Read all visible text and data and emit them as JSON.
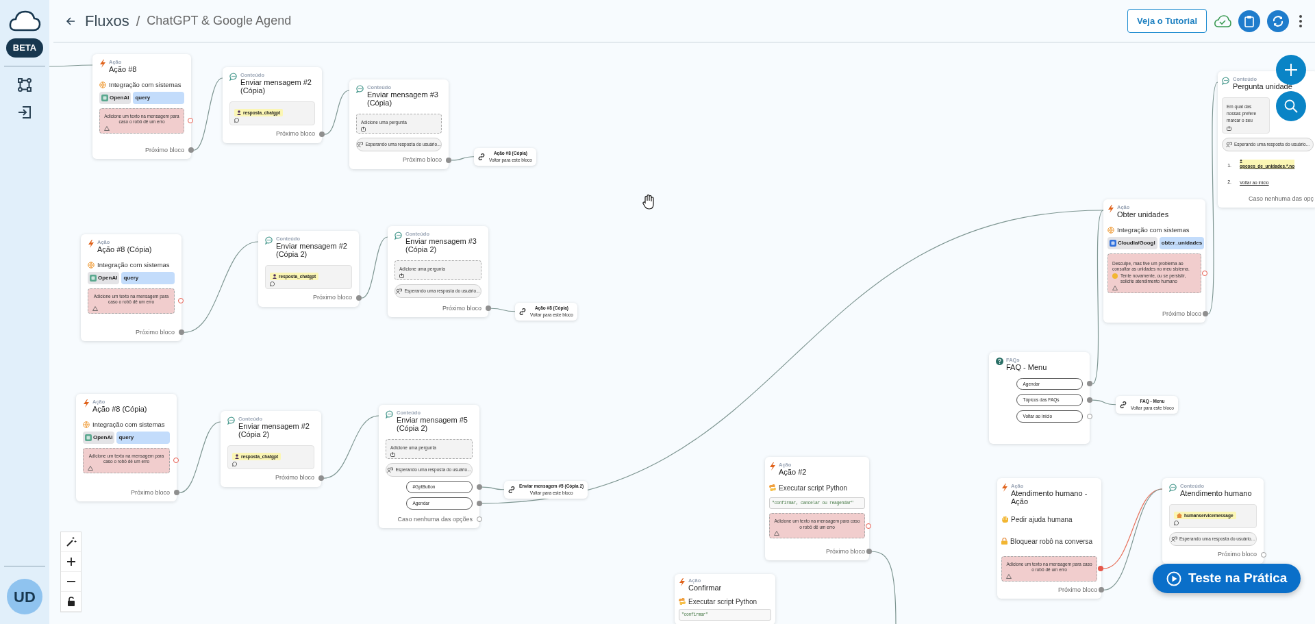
{
  "sidebar": {
    "badge": "BETA",
    "avatar": "UD"
  },
  "header": {
    "breadcrumb": "Fluxos",
    "separator": "/",
    "title": "ChatGPT & Google Agend",
    "tutorial_button": "Veja o Tutorial"
  },
  "nodes": [
    {
      "kind": "action",
      "category": "Ação",
      "title": "Ação #8",
      "items": [
        {
          "kind": "integration",
          "label": "Integração com sistemas",
          "service": "OpenAI",
          "color": "#5aa88f",
          "method": "query"
        },
        {
          "kind": "error",
          "text": "Adicione um texto na mensagem para caso o robô dê um erro",
          "connected": false
        },
        {
          "kind": "next",
          "label": "Próximo bloco",
          "connected": true
        }
      ]
    },
    {
      "kind": "content",
      "category": "Conteúdo",
      "title": "Enviar mensagem #2 (Cópia)",
      "items": [
        {
          "kind": "message",
          "variable": "resposta_chatgpt"
        },
        {
          "kind": "next",
          "label": "Próximo bloco",
          "connected": true
        }
      ]
    },
    {
      "kind": "content",
      "category": "Conteúdo",
      "title": "Enviar mensagem #3 (Cópia)",
      "items": [
        {
          "kind": "question",
          "text": "Adicione uma pergunta"
        },
        {
          "kind": "waiting",
          "text": "Esperando uma resposta do usuário..."
        },
        {
          "kind": "next",
          "label": "Próximo bloco",
          "connected": true
        }
      ]
    },
    {
      "kind": "action",
      "category": "Ação",
      "title": "Ação #8 (Cópia)",
      "items": [
        {
          "kind": "integration",
          "label": "Integração com sistemas",
          "service": "OpenAI",
          "color": "#5aa88f",
          "method": "query"
        },
        {
          "kind": "error",
          "text": "Adicione um texto na mensagem para caso o robô dê um erro",
          "connected": false
        },
        {
          "kind": "next",
          "label": "Próximo bloco",
          "connected": true
        }
      ]
    },
    {
      "kind": "content",
      "category": "Conteúdo",
      "title": "Enviar mensagem #2 (Cópia 2)",
      "items": [
        {
          "kind": "message",
          "variable": "resposta_chatgpt"
        },
        {
          "kind": "next",
          "label": "Próximo bloco",
          "connected": true
        }
      ]
    },
    {
      "kind": "content",
      "category": "Conteúdo",
      "title": "Enviar mensagem #3 (Cópia 2)",
      "items": [
        {
          "kind": "question",
          "text": "Adicione uma pergunta"
        },
        {
          "kind": "waiting",
          "text": "Esperando uma resposta do usuário..."
        },
        {
          "kind": "next",
          "label": "Próximo bloco",
          "connected": true
        }
      ]
    },
    {
      "kind": "action",
      "category": "Ação",
      "title": "Ação #8 (Cópia)",
      "items": [
        {
          "kind": "integration",
          "label": "Integração com sistemas",
          "service": "OpenAI",
          "color": "#5aa88f",
          "method": "query"
        },
        {
          "kind": "error",
          "text": "Adicione um texto na mensagem para caso o robô dê um erro",
          "connected": false
        },
        {
          "kind": "next",
          "label": "Próximo bloco",
          "connected": true
        }
      ]
    },
    {
      "kind": "content",
      "category": "Conteúdo",
      "title": "Enviar mensagem #2 (Cópia 2)",
      "items": [
        {
          "kind": "message",
          "variable": "resposta_chatgpt"
        },
        {
          "kind": "next",
          "label": "Próximo bloco",
          "connected": true
        }
      ]
    },
    {
      "kind": "content",
      "category": "Conteúdo",
      "title": "Enviar mensagem #5 (Cópia 2)",
      "items": [
        {
          "kind": "question",
          "text": "Adicione uma pergunta"
        },
        {
          "kind": "waiting",
          "text": "Esperando uma resposta do usuário..."
        },
        {
          "kind": "option",
          "label": "#GptButton",
          "connected": true
        },
        {
          "kind": "option",
          "label": "Agendar",
          "connected": true
        },
        {
          "kind": "next",
          "label": "Caso nenhuma das opções",
          "connected": false
        }
      ]
    },
    {
      "kind": "content",
      "category": "Conteúdo",
      "title": "Pergunta unidade",
      "items": [
        {
          "kind": "text",
          "text": "Em qual das nossas prefere marcar o seu"
        },
        {
          "kind": "waiting",
          "text": "Esperando uma resposta do usuário..."
        },
        {
          "kind": "numbered_variable",
          "number": "1.",
          "text": "opcoes_de_unidades.*.no"
        },
        {
          "kind": "numbered_link",
          "number": "2.",
          "text": "Voltar ao início"
        },
        {
          "kind": "next",
          "label": "Caso nenhuma das opç"
        }
      ]
    },
    {
      "kind": "action",
      "category": "Ação",
      "title": "Obter unidades",
      "items": [
        {
          "kind": "integration",
          "label": "Integração com sistemas",
          "service": "Cloudia/Googl",
          "color": "#2f6fdb",
          "method": "obter_unidades"
        },
        {
          "kind": "error",
          "text": "Desculpe, mas tive um problema ao consultar as unidades no meu sistema.",
          "text_after": "Tente novamente, ou se persistir, solicite atendimento humano",
          "connected": false
        },
        {
          "kind": "next",
          "label": "Próximo bloco",
          "connected": true
        }
      ]
    },
    {
      "kind": "faq",
      "category": "FAQs",
      "title": "FAQ - Menu",
      "items": [
        {
          "kind": "option",
          "label": "Agendar",
          "connected": true
        },
        {
          "kind": "option",
          "label": "Tópicos das FAQs",
          "connected": true
        },
        {
          "kind": "option",
          "label": "Voltar ao início",
          "connected": false
        }
      ]
    },
    {
      "kind": "action",
      "category": "Ação",
      "title": "Ação #2",
      "items": [
        {
          "kind": "script",
          "label": "Executar script Python",
          "code": "\"confirmar, cancelar ou reagendar\""
        },
        {
          "kind": "error",
          "text": "Adicione um texto na mensagem para caso o robô dê um erro",
          "connected": false
        },
        {
          "kind": "next",
          "label": "Próximo bloco",
          "connected": true
        }
      ]
    },
    {
      "kind": "action",
      "category": "Ação",
      "title": "Atendimento humano - Ação",
      "items": [
        {
          "kind": "help",
          "label": "Pedir ajuda humana"
        },
        {
          "kind": "lock",
          "label": "Bloquear robô na conversa"
        },
        {
          "kind": "error",
          "text": "Adicione um texto na mensagem para caso o robô dê um erro",
          "connected": true
        },
        {
          "kind": "next",
          "label": "Próximo bloco",
          "connected": true
        }
      ]
    },
    {
      "kind": "content",
      "category": "Conteúdo",
      "title": "Atendimento humano",
      "items": [
        {
          "kind": "system_message",
          "variable": "humanservicemessage"
        },
        {
          "kind": "waiting",
          "text": "Esperando uma resposta do usuário..."
        },
        {
          "kind": "next",
          "label": "Próximo bloco",
          "connected": false
        }
      ]
    },
    {
      "kind": "action",
      "category": "Ação",
      "title": "Confirmar",
      "items": [
        {
          "kind": "script",
          "label": "Executar script Python",
          "code": "\"confirmar\""
        }
      ]
    }
  ],
  "links": [
    {
      "title": "Ação #8 (Cópia)",
      "subtitle": "Voltar para este bloco"
    },
    {
      "title": "Ação #8 (Cópia)",
      "subtitle": "Voltar para este bloco"
    },
    {
      "title": "Enviar mensagem #5 (Cópia 2)",
      "subtitle": "Voltar para este bloco"
    },
    {
      "title": "FAQ - Menu",
      "subtitle": "Voltar para este bloco"
    }
  ],
  "test_button": "Teste na Prática"
}
